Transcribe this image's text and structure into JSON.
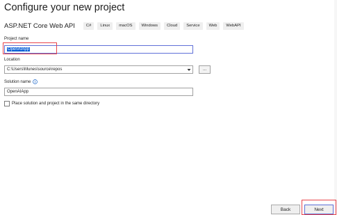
{
  "page": {
    "title": "Configure your new project"
  },
  "template": {
    "name": "ASP.NET Core Web API",
    "tags": [
      "C#",
      "Linux",
      "macOS",
      "Windows",
      "Cloud",
      "Service",
      "Web",
      "WebAPI"
    ]
  },
  "project_name": {
    "label": "Project name",
    "value": "OpenAIApp"
  },
  "location": {
    "label": "Location",
    "value": "C:\\Users\\Munes\\source\\repos",
    "browse_label": "..."
  },
  "solution_name": {
    "label": "Solution name",
    "value": "OpenAIApp",
    "info_icon": "info-icon"
  },
  "same_directory": {
    "label": "Place solution and project in the same directory",
    "checked": false
  },
  "footer": {
    "back_label": "Back",
    "next_label": "Next"
  },
  "colors": {
    "accent": "#0a5fd6",
    "annotation": "#e8444a"
  }
}
